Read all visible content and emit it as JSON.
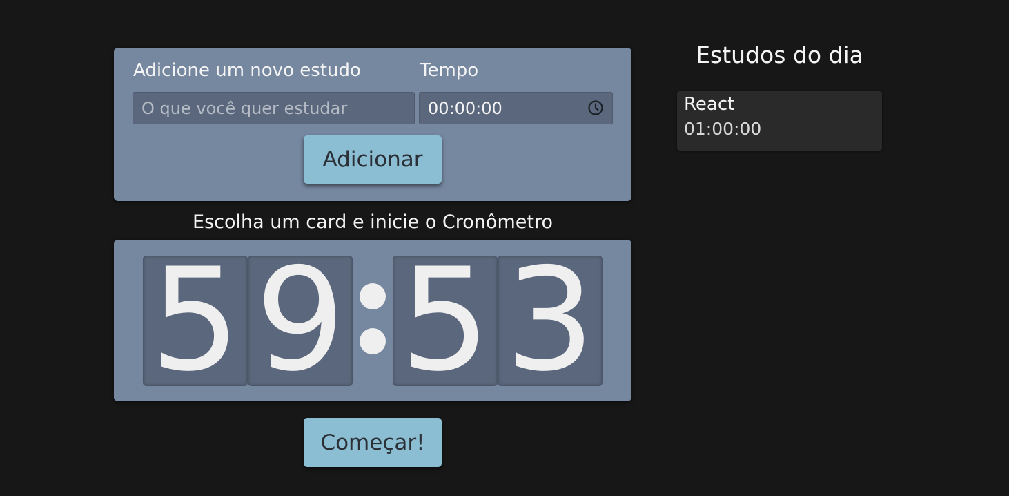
{
  "form": {
    "study_label": "Adicione um novo estudo",
    "time_label": "Tempo",
    "study_placeholder": "O que você quer estudar",
    "time_value": "00:00:00",
    "add_button": "Adicionar"
  },
  "chronometer": {
    "title": "Escolha um card e inicie o Cronômetro",
    "digits": [
      "5",
      "9",
      "5",
      "3"
    ],
    "start_button": "Começar!"
  },
  "sidebar": {
    "title": "Estudos do dia",
    "items": [
      {
        "name": "React",
        "time": "01:00:00"
      }
    ]
  },
  "colors": {
    "background": "#171717",
    "card": "#7687a0",
    "input": "#5b677c",
    "button": "#8bbdd3",
    "list_item": "#2a2a2a"
  },
  "icons": {
    "time_field": "clock-icon"
  }
}
